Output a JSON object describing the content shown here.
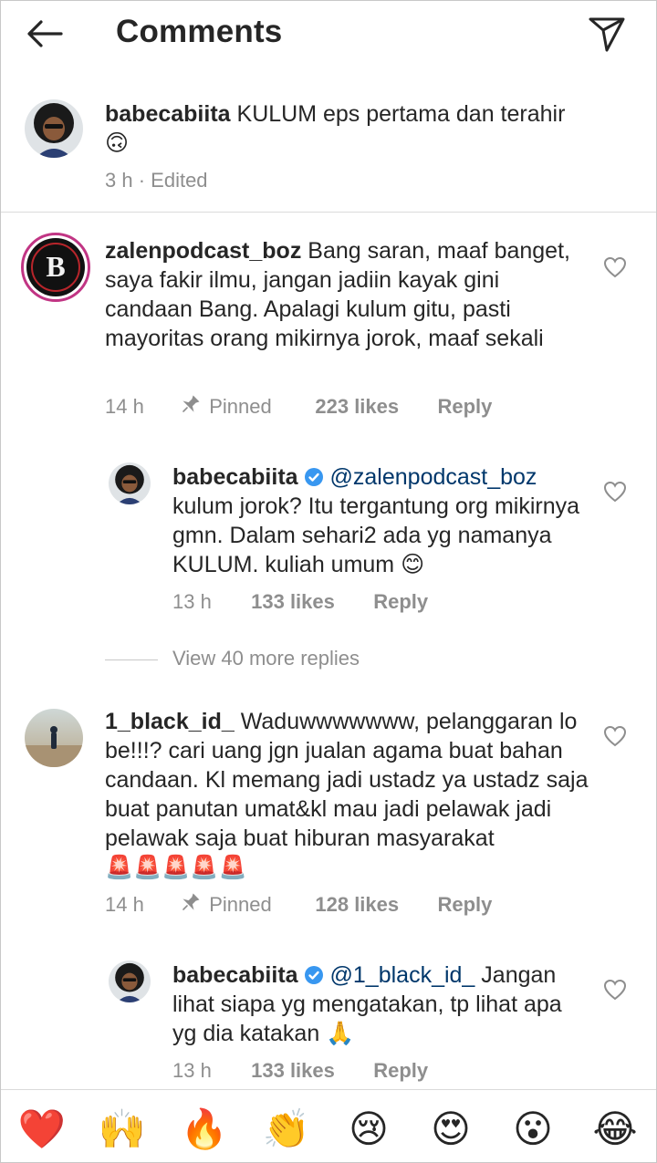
{
  "header": {
    "title": "Comments"
  },
  "caption": {
    "username": "babecabiita",
    "text": "KULUM eps pertama dan terahir",
    "emoji": "🙃",
    "time": "3 h",
    "separator": " · ",
    "edited": "Edited"
  },
  "comments": [
    {
      "username": "zalenpodcast_boz",
      "text": "Bang saran, maaf banget, saya fakir ilmu, jangan jadiin kayak gini candaan Bang. Apalagi kulum gitu, pasti mayoritas orang mikirnya jorok, maaf sekali",
      "time": "14 h",
      "pinned": "Pinned",
      "likes": "223 likes",
      "reply": "Reply"
    },
    {
      "username": "babecabiita",
      "mention": "@zalenpodcast_boz",
      "text": "kulum jorok? Itu tergantung org mikirnya gmn. Dalam sehari2 ada yg namanya KULUM. kuliah umum",
      "emoji": "😊",
      "time": "13 h",
      "likes": "133 likes",
      "reply": "Reply"
    },
    {
      "username": "1_black_id_",
      "text": "Waduwwwwwww, pelanggaran lo be!!!? cari uang jgn jualan agama buat bahan candaan. Kl memang jadi ustadz ya ustadz saja buat panutan umat&kl mau jadi pelawak jadi pelawak saja buat hiburan masyarakat",
      "emoji": "🚨🚨🚨🚨🚨",
      "time": "14 h",
      "pinned": "Pinned",
      "likes": "128 likes",
      "reply": "Reply"
    },
    {
      "username": "babecabiita",
      "mention": "@1_black_id_",
      "text": "Jangan lihat siapa yg mengatakan, tp lihat apa yg dia katakan",
      "emoji": "🙏",
      "time": "13 h",
      "likes": "133 likes",
      "reply": "Reply"
    }
  ],
  "view_more": "View 40 more replies",
  "emoji_bar": [
    "❤️",
    "🙌",
    "🔥",
    "👏",
    "😢",
    "😍",
    "😮",
    "😂"
  ],
  "colors": {
    "verified": "#3897f0",
    "mention": "#00376b",
    "muted": "#8e8e8e"
  },
  "icons": [
    "back-arrow-icon",
    "send-icon",
    "heart-outline-icon",
    "pin-icon",
    "verified-badge-icon"
  ]
}
